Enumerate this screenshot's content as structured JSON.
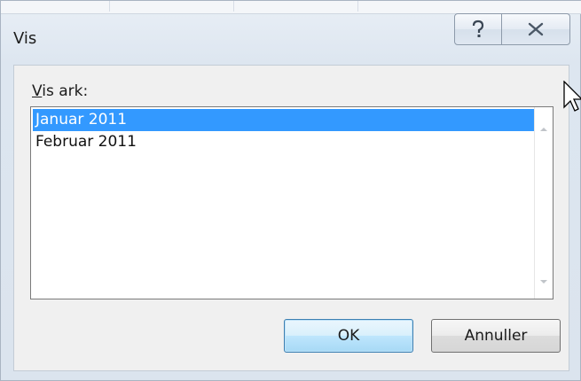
{
  "window": {
    "title": "Vis",
    "help_icon": "help-icon",
    "close_icon": "close-icon"
  },
  "dialog": {
    "label_mnemonic": "V",
    "label_rest": "is ark:",
    "sheets": [
      {
        "label": "Januar 2011",
        "selected": true
      },
      {
        "label": "Februar 2011",
        "selected": false
      }
    ],
    "scroll_up_icon": "scroll-up-arrow-icon",
    "scroll_down_icon": "scroll-down-arrow-icon"
  },
  "buttons": {
    "ok_label": "OK",
    "cancel_label": "Annuller"
  },
  "colors": {
    "selection": "#3399ff",
    "ok_border": "#3c7fb1"
  }
}
